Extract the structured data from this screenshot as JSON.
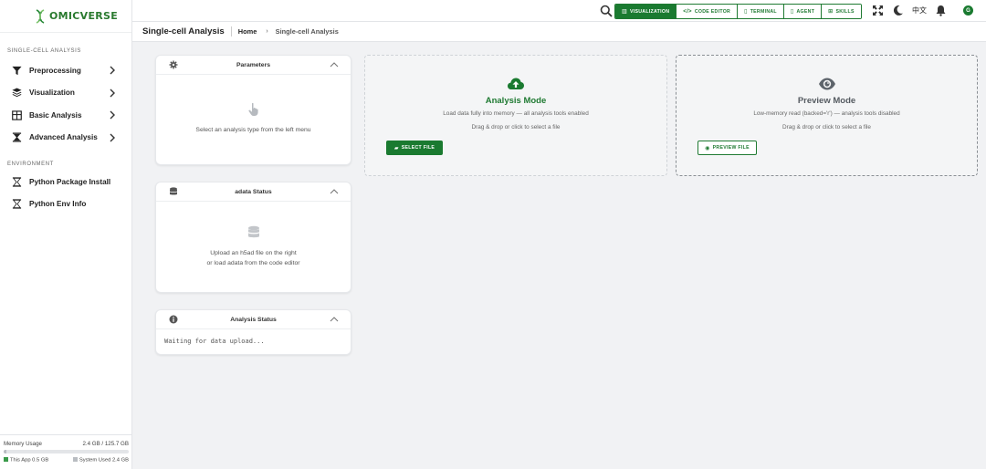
{
  "app": {
    "logo_text": "OMICVERSE"
  },
  "sidebar": {
    "section_analysis": "SINGLE-CELL ANALYSIS",
    "items": [
      {
        "label": "Preprocessing",
        "icon": "filter-icon"
      },
      {
        "label": "Visualization",
        "icon": "layers-icon"
      },
      {
        "label": "Basic Analysis",
        "icon": "table-icon"
      },
      {
        "label": "Advanced Analysis",
        "icon": "hourglass-icon"
      }
    ],
    "section_env": "ENVIRONMENT",
    "env_items": [
      {
        "label": "Python Package Install",
        "icon": "hourglass-outline-icon"
      },
      {
        "label": "Python Env Info",
        "icon": "hourglass-outline-icon"
      }
    ]
  },
  "memory": {
    "label": "Memory Usage",
    "value": "2.4 GB / 125.7 GB",
    "used_fraction": 0.019,
    "this_app": "This App 0.5 GB",
    "system_used": "System Used 2.4 GB",
    "colors": {
      "this_app": "#3a9a4a",
      "system": "#b9bdc2"
    }
  },
  "topbar": {
    "tabs": [
      {
        "label": "VISUALIZATION",
        "icon": "chart-icon",
        "active": true
      },
      {
        "label": "CODE EDITOR",
        "icon": "code-icon",
        "active": false
      },
      {
        "label": "TERMINAL",
        "icon": "file-icon",
        "active": false
      },
      {
        "label": "AGENT",
        "icon": "file-icon",
        "active": false
      },
      {
        "label": "SKILLS",
        "icon": "grid-icon",
        "active": false
      }
    ],
    "language": "中文",
    "avatar_letter": "G"
  },
  "breadcrumb": {
    "page_title": "Single-cell Analysis",
    "home": "Home",
    "separator": "›",
    "current": "Single-cell Analysis"
  },
  "cards": {
    "parameters": {
      "title": "Parameters",
      "body": "Select an analysis type from the left menu"
    },
    "adata": {
      "title": "adata Status",
      "line1": "Upload an h5ad file on the right",
      "line2": "or load adata from the code editor"
    },
    "analysis_status": {
      "title": "Analysis Status",
      "body": "Waiting for data upload..."
    }
  },
  "upload": {
    "analysis": {
      "title": "Analysis Mode",
      "desc": "Load data fully into memory — all analysis tools enabled",
      "drop": "Drag & drop or click to select a file",
      "button": "SELECT FILE"
    },
    "preview": {
      "title": "Preview Mode",
      "desc": "Low-memory read (backed='r') — analysis tools disabled",
      "drop": "Drag & drop or click to select a file",
      "button": "PREVIEW FILE"
    }
  },
  "colors": {
    "brand_green": "#1a7a30",
    "analysis_title": "#1f7a32",
    "preview_title": "#555b61"
  }
}
